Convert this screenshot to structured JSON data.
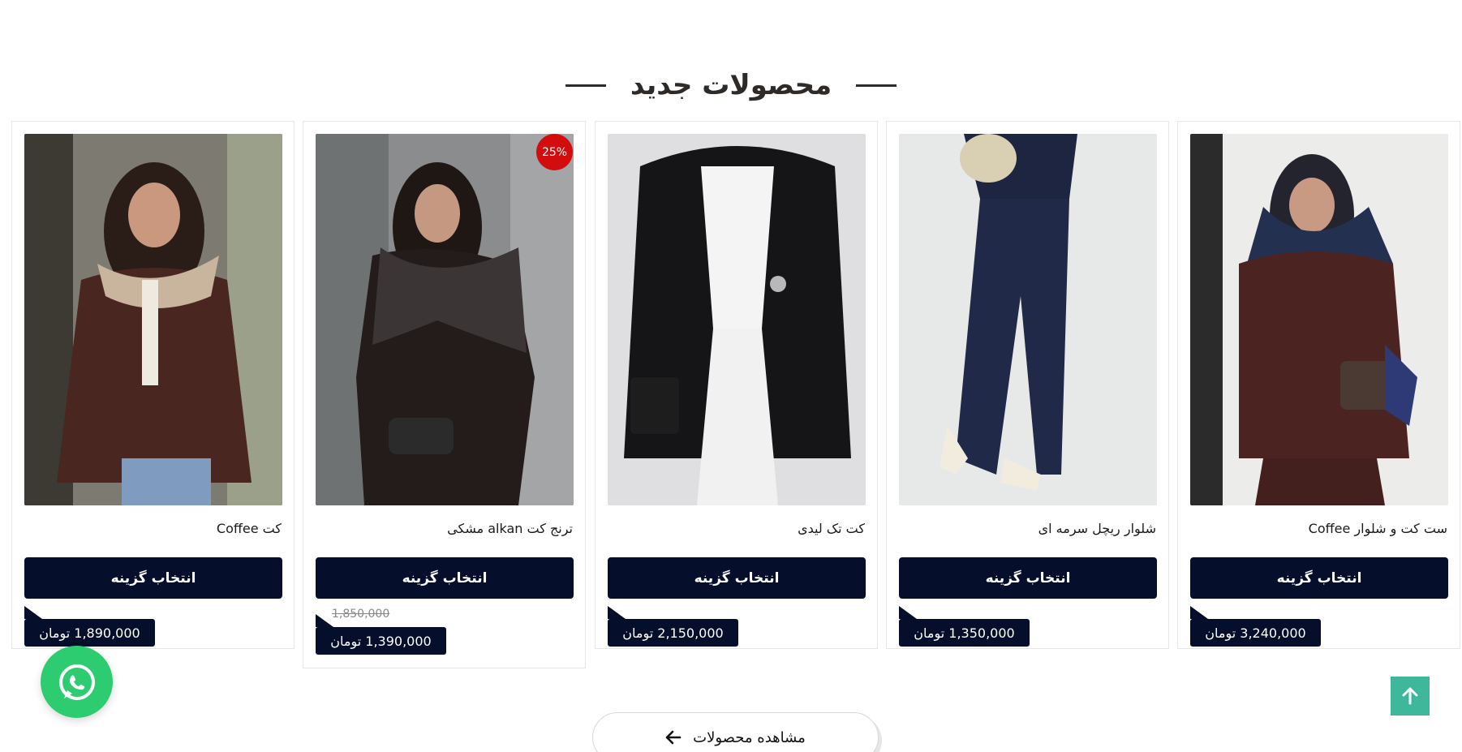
{
  "section": {
    "title": "محصولات جدید"
  },
  "products": [
    {
      "name": "کت Coffee",
      "button": "انتخاب گزینه",
      "price": "1,890,000 تومان",
      "old_price": null,
      "badge": null
    },
    {
      "name": "ترنج کت alkan مشکی",
      "button": "انتخاب گزینه",
      "price": "1,390,000 تومان",
      "old_price": "1,850,000",
      "badge": "25%"
    },
    {
      "name": "کت تک لیدی",
      "button": "انتخاب گزینه",
      "price": "2,150,000 تومان",
      "old_price": null,
      "badge": null
    },
    {
      "name": "شلوار ریچل سرمه ای",
      "button": "انتخاب گزینه",
      "price": "1,350,000 تومان",
      "old_price": null,
      "badge": null
    },
    {
      "name": "ست کت و شلوار Coffee",
      "button": "انتخاب گزینه",
      "price": "3,240,000 تومان",
      "old_price": null,
      "badge": null
    }
  ],
  "footer": {
    "view_all": "مشاهده محصولات"
  },
  "colors": {
    "primary": "#050f2c",
    "sale": "#d30d0d",
    "whatsapp": "#2ecc71",
    "to_top": "#3fb79a"
  }
}
